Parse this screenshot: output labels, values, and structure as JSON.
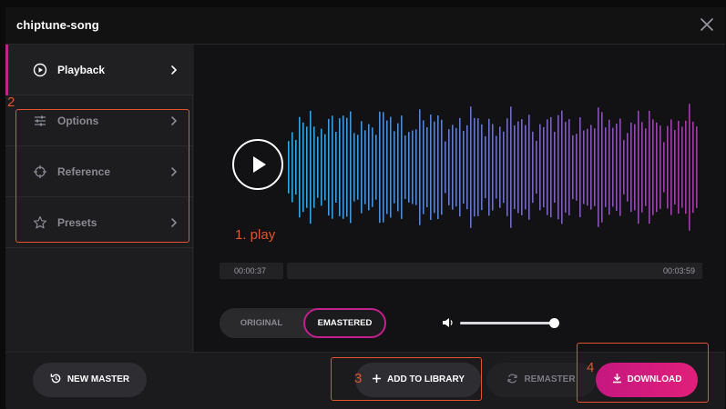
{
  "window": {
    "title": "chiptune-song"
  },
  "sidebar": {
    "items": [
      {
        "label": "Playback",
        "icon": "play-circle-icon"
      },
      {
        "label": "Options",
        "icon": "sliders-icon"
      },
      {
        "label": "Reference",
        "icon": "crosshair-icon"
      },
      {
        "label": "Presets",
        "icon": "star-icon"
      }
    ]
  },
  "player": {
    "current_time": "00:00:37",
    "total_time": "00:03:59",
    "volume": 0.95
  },
  "mode_toggle": {
    "original_label": "ORIGINAL",
    "remastered_label": "EMASTERED",
    "selected": "EMASTERED"
  },
  "footer": {
    "new_master_label": "NEW MASTER",
    "add_library_label": "ADD TO LIBRARY",
    "remaster_label": "REMASTER",
    "download_label": "DOWNLOAD"
  },
  "annotations": {
    "n1": "1. play",
    "n2": "2",
    "n3": "3",
    "n4": "4"
  },
  "colors": {
    "accent": "#c41f8e",
    "wave_start": "#30a8e4",
    "wave_end": "#a53aa6",
    "annotation": "#e2542b"
  }
}
